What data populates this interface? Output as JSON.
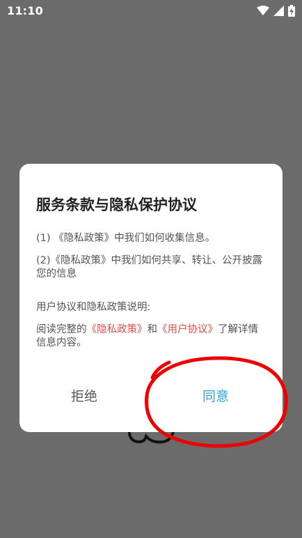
{
  "status_bar": {
    "time": "11:10",
    "icons": [
      "wifi-icon",
      "signal-icon",
      "battery-charging-icon"
    ]
  },
  "dialog": {
    "title": "服务条款与隐私保护协议",
    "item1": "(1) 《隐私政策》中我们如何收集信息。",
    "item2": "(2)《隐私政策》中我们如何共享、转让、公开披露您的信息",
    "item3": "用户协议和隐私政策说明:",
    "desc_prefix": "阅读完整的",
    "privacy_link": "《隐私政策》",
    "desc_and": "和",
    "user_agreement_link": "《用户协议》",
    "desc_suffix": "了解详情信息内容。",
    "reject_label": "拒绝",
    "agree_label": "同意"
  },
  "colors": {
    "overlay": "#6b6b6b",
    "link": "#e0524b",
    "agree": "#2aa6e0",
    "annotation": "#ee0000"
  }
}
